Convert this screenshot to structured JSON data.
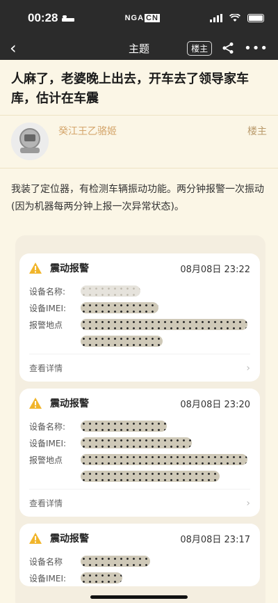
{
  "status_bar": {
    "time": "00:28",
    "logo": "NGA",
    "logo_suffix": "CN"
  },
  "nav": {
    "back": "‹",
    "title": "主题",
    "louzhu": "楼主"
  },
  "thread": {
    "title": "人麻了，老婆晚上出去，开车去了领导家车库，估计在车震"
  },
  "author": {
    "name": "癸江王乙骆姬",
    "badge": "楼主"
  },
  "post": {
    "body": "我装了定位器，有检测车辆振动功能。两分钟报警一次振动(因为机器每两分钟上报一次异常状态)。"
  },
  "alerts": [
    {
      "title": "震动报警",
      "time": "08月08日 23:22",
      "device_name_label": "设备名称:",
      "imei_label": "设备IMEI:",
      "location_label": "报警地点",
      "detail": "查看详情"
    },
    {
      "title": "震动报警",
      "time": "08月08日 23:20",
      "device_name_label": "设备名称:",
      "imei_label": "设备IMEI:",
      "location_label": "报警地点",
      "detail": "查看详情"
    },
    {
      "title": "震动报警",
      "time": "08月08日 23:17",
      "device_name_label": "设备名称",
      "imei_label": "设备IMEI:"
    }
  ],
  "colors": {
    "header_bg": "#2b2b2b",
    "page_bg": "#fbf6e6",
    "author_name": "#d4a56b",
    "warn": "#f1b52b"
  }
}
